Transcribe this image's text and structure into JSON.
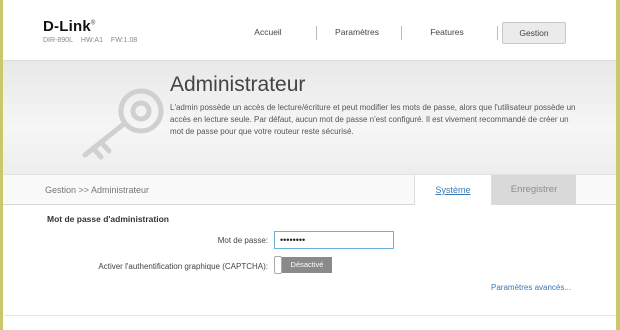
{
  "header": {
    "logo": "D-Link",
    "logo_mark": "®",
    "model": "DIR-890L",
    "hw": "HW:A1",
    "fw": "FW:1.08"
  },
  "nav": {
    "items": [
      {
        "label": "Accueil"
      },
      {
        "label": "Paramètres"
      },
      {
        "label": "Features"
      },
      {
        "label": "Gestion",
        "active": true
      }
    ]
  },
  "hero": {
    "icon": "key-icon",
    "title": "Administrateur",
    "description": "L'admin possède un accès de lecture/écriture et peut modifier les mots de passe, alors que l'utilisateur possède un accès en lecture seule. Par défaut, aucun mot de passe n'est configuré. Il est vivement recommandé de créer un mot de passe pour que votre routeur reste sécurisé."
  },
  "bar": {
    "breadcrumb": "Gestion >> Administrateur",
    "tab_system": "Système",
    "save": "Enregistrer"
  },
  "form": {
    "section_title": "Mot de passe d'administration",
    "password_label": "Mot de passe:",
    "password_value": "••••••••",
    "captcha_label": "Activer l'authentification graphique (CAPTCHA):",
    "captcha_state": "Désactivé",
    "advanced": "Paramètres avancés..."
  },
  "colors": {
    "frame": "#c9c86a",
    "link": "#3a78b5",
    "input_border": "#6ab0d8",
    "save_disabled": "#d9d9d9"
  }
}
